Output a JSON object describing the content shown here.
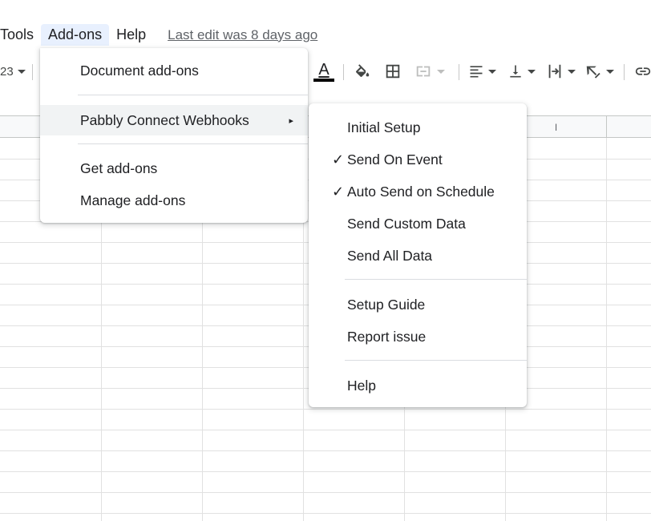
{
  "menubar": {
    "items": [
      {
        "label": "Tools"
      },
      {
        "label": "Add-ons"
      },
      {
        "label": "Help"
      }
    ],
    "last_edit": "Last edit was 8 days ago"
  },
  "toolbar": {
    "zoom_value": "23",
    "text_color_glyph": "A",
    "icons": [
      "text-color-icon",
      "fill-color-icon",
      "borders-icon",
      "merge-cells-icon",
      "align-left-icon",
      "vertical-align-bottom-icon",
      "text-wrap-icon",
      "text-rotation-icon",
      "insert-link-icon"
    ]
  },
  "grid": {
    "visible_column_header": "I"
  },
  "addons_menu": {
    "items": [
      {
        "label": "Document add-ons"
      },
      {
        "label": "Pabbly Connect Webhooks",
        "submenu_arrow": "▸"
      },
      {
        "label": "Get add-ons"
      },
      {
        "label": "Manage add-ons"
      }
    ]
  },
  "submenu": {
    "items": [
      {
        "label": "Initial Setup",
        "checked": false
      },
      {
        "label": "Send On Event",
        "checked": true,
        "check_glyph": "✓"
      },
      {
        "label": "Auto Send on Schedule",
        "checked": true,
        "check_glyph": "✓"
      },
      {
        "label": "Send Custom Data",
        "checked": false
      },
      {
        "label": "Send All Data",
        "checked": false
      },
      {
        "label": "Setup Guide",
        "checked": false
      },
      {
        "label": "Report issue",
        "checked": false
      },
      {
        "label": "Help",
        "checked": false
      }
    ]
  },
  "colors": {
    "menu_active_bg": "#e8f0fe",
    "row_hover_bg": "#f1f3f4",
    "text": "#202124",
    "muted": "#5f6368"
  }
}
